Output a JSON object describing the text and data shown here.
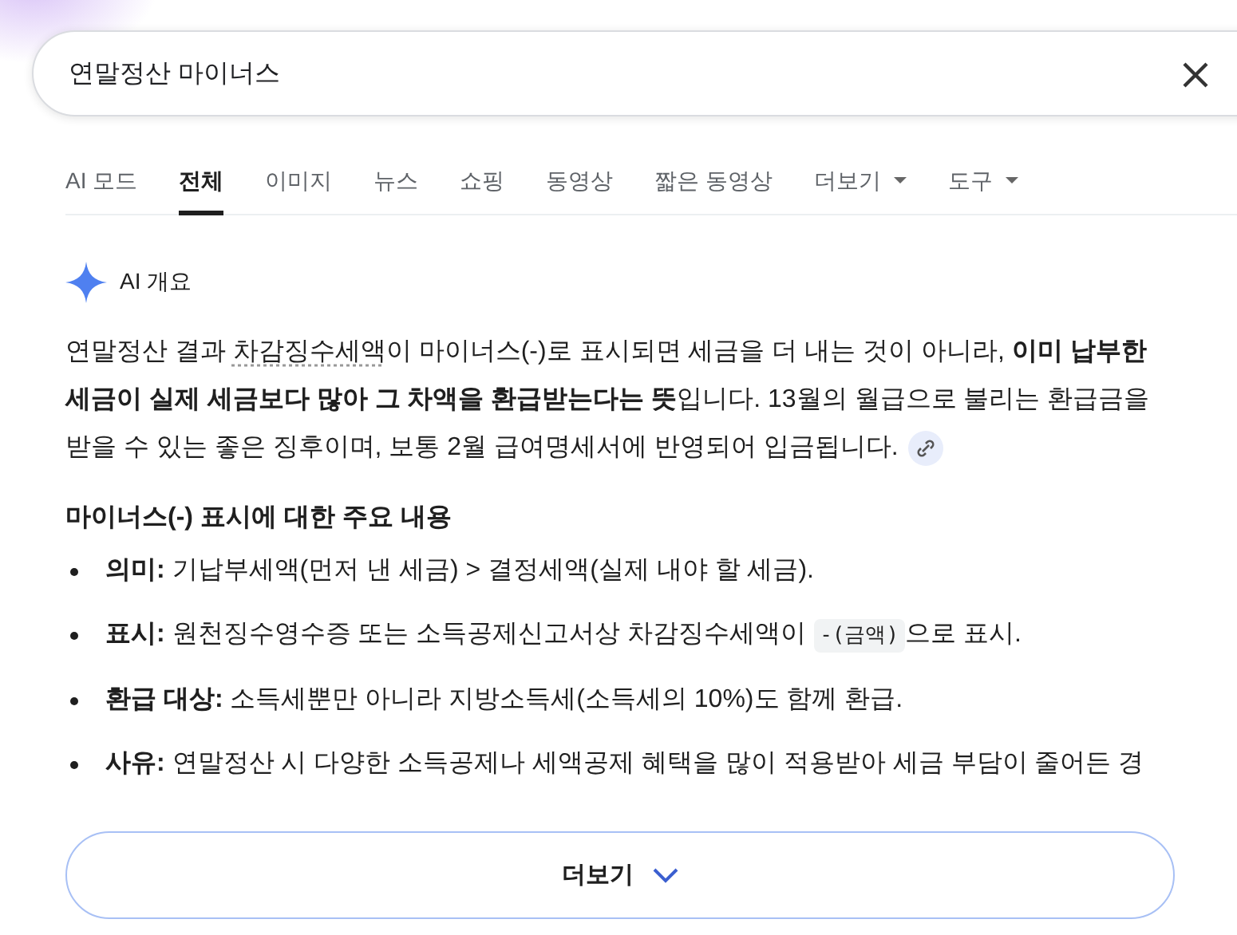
{
  "search": {
    "value": "연말정산 마이너스"
  },
  "tabs": [
    {
      "label": "AI 모드",
      "selected": false,
      "dropdown": false
    },
    {
      "label": "전체",
      "selected": true,
      "dropdown": false
    },
    {
      "label": "이미지",
      "selected": false,
      "dropdown": false
    },
    {
      "label": "뉴스",
      "selected": false,
      "dropdown": false
    },
    {
      "label": "쇼핑",
      "selected": false,
      "dropdown": false
    },
    {
      "label": "동영상",
      "selected": false,
      "dropdown": false
    },
    {
      "label": "짧은 동영상",
      "selected": false,
      "dropdown": false
    },
    {
      "label": "더보기",
      "selected": false,
      "dropdown": true
    },
    {
      "label": "도구",
      "selected": false,
      "dropdown": true
    }
  ],
  "overview": {
    "title": "AI 개요",
    "paragraph": [
      {
        "kind": "plain",
        "text": "연말정산 결과 "
      },
      {
        "kind": "term",
        "text": "차감징수세액"
      },
      {
        "kind": "plain",
        "text": "이 마이너스(-)로 표시되면 세금을 더 내는 것이 아니라, "
      },
      {
        "kind": "bold",
        "text": "이미 납부한 세금이 실제 세금보다 많아 그 차액을 환급받는다는 뜻"
      },
      {
        "kind": "plain",
        "text": "입니다. 13월의 월급으로 불리는 환급금을 받을 수 있는 좋은 징후이며, 보통 2월 급여명세서에 반영되어 입금됩니다."
      }
    ],
    "heading": "마이너스(-) 표시에 대한 주요 내용",
    "items": [
      {
        "label": "의미:",
        "parts": [
          {
            "kind": "plain",
            "text": "기납부세액(먼저 낸 세금) > 결정세액(실제 내야 할 세금)."
          }
        ]
      },
      {
        "label": "표시:",
        "parts": [
          {
            "kind": "plain",
            "text": "원천징수영수증 또는 소득공제신고서상 차감징수세액이 "
          },
          {
            "kind": "code",
            "text": "-(금액)"
          },
          {
            "kind": "plain",
            "text": "으로 표시."
          }
        ]
      },
      {
        "label": "환급 대상:",
        "parts": [
          {
            "kind": "plain",
            "text": "소득세뿐만 아니라 지방소득세(소득세의 10%)도 함께 환급."
          }
        ]
      },
      {
        "label": "사유:",
        "parts": [
          {
            "kind": "plain",
            "text": "연말정산 시 다양한 소득공제나 세액공제 혜택을 많이 적용받아 세금 부담이 줄어든 경"
          }
        ]
      }
    ],
    "more_button": "더보기"
  }
}
